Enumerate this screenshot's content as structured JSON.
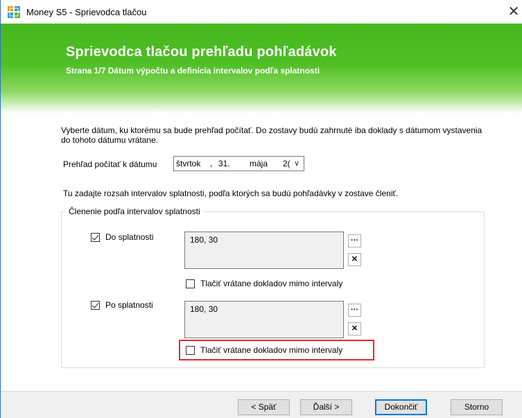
{
  "window": {
    "title": "Money S5 - Sprievodca tlačou",
    "close_glyph": "✕"
  },
  "banner": {
    "title": "Sprievodca tlačou prehľadu pohľadávok",
    "subtitle": "Strana 1/7 Dátum výpočtu a definícia intervalov podľa splatnosti"
  },
  "intro": {
    "text": "Vyberte dátum, ku ktorému sa bude prehľad počítať. Do zostavy budú zahrnuté iba doklady s dátumom vystavenia do tohoto dátumu vrátane."
  },
  "date": {
    "label": "Prehľad počítať k dátumu",
    "weekday": "štvrtok",
    "sep": ",",
    "day": "31.",
    "month": "mája",
    "year_partial": "2(",
    "dropdown_glyph": "∨"
  },
  "range_text": "Tu zadajte rozsah intervalov splatnosti, podľa ktorých sa budú pohľadávky v zostave členiť.",
  "group": {
    "legend": "Členenie podľa intervalov splatnosti",
    "do": {
      "checkbox_label": "Do splatnosti",
      "checked": true,
      "value": "180, 30",
      "mimo_label": "Tlačiť vrátane dokladov mimo intervaly",
      "mimo_checked": false
    },
    "po": {
      "checkbox_label": "Po splatnosti",
      "checked": true,
      "value": "180, 30",
      "mimo_label": "Tlačiť vrátane dokladov mimo intervaly",
      "mimo_checked": false
    },
    "browse_glyph": "···",
    "clear_glyph": "✕"
  },
  "buttons": {
    "back": "< Späť",
    "next": "Ďalší >",
    "finish": "Dokončiť",
    "cancel": "Storno"
  },
  "colors": {
    "banner_green": "#4fbf25",
    "highlight_red": "#e8262b",
    "default_button_border": "#0078d7"
  }
}
